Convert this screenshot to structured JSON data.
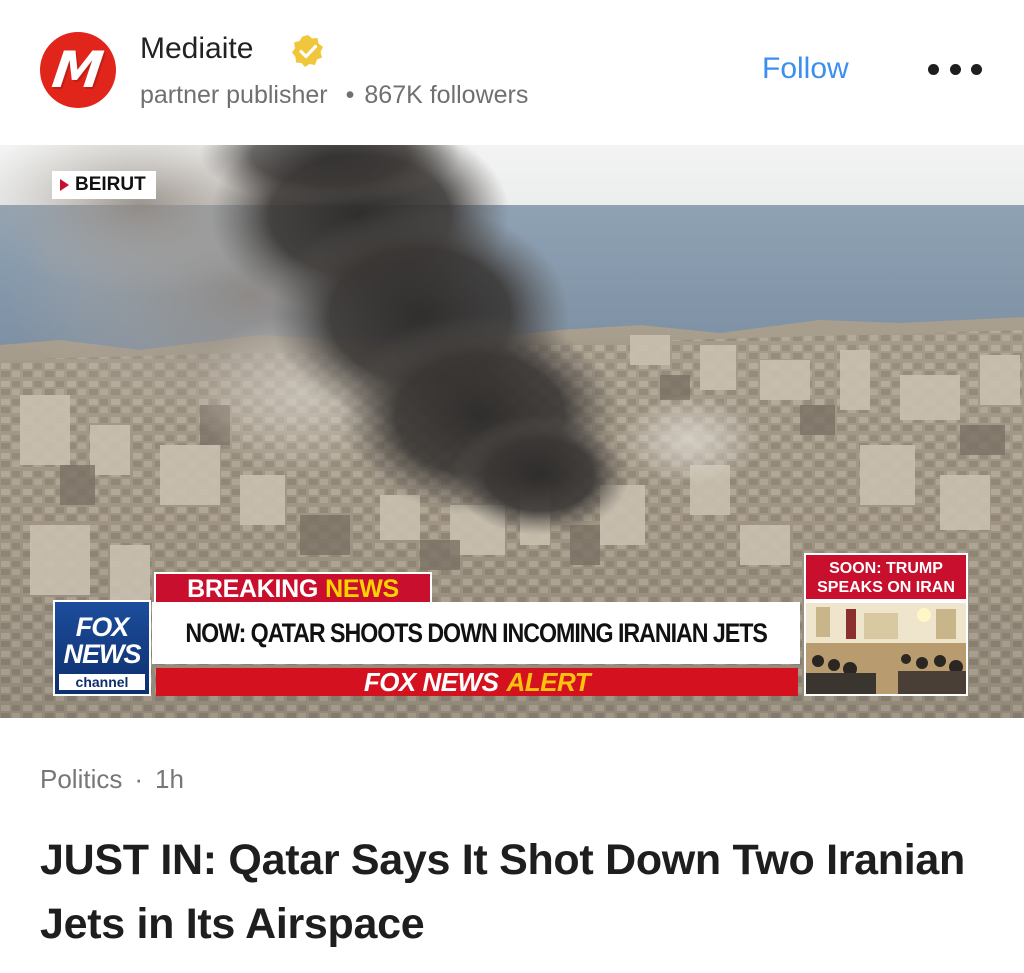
{
  "publisher": {
    "logo_letter": "M",
    "name": "Mediaite",
    "verified": true,
    "role": "partner publisher",
    "followers": "867K followers",
    "follow_label": "Follow",
    "more_icon": "more-icon"
  },
  "media": {
    "dateline": "BEIRUT",
    "breaking_left": "BREAKING",
    "breaking_right": "NEWS",
    "network_logo_top": "FOX",
    "network_logo_bottom": "NEWS",
    "network_logo_channel": "channel",
    "headline": "NOW: QATAR SHOOTS DOWN INCOMING IRANIAN JETS",
    "alert_left": "FOX NEWS",
    "alert_right": "ALERT",
    "soon_line1": "SOON: TRUMP",
    "soon_line2": "SPEAKS ON IRAN"
  },
  "article": {
    "category": "Politics",
    "age": "1h",
    "title": "JUST IN: Qatar Says It Shot Down Two Iranian Jets in Its Airspace"
  },
  "colors": {
    "brand_red": "#e1251b",
    "follow_blue": "#3b8ff0",
    "fox_red": "#c8102e",
    "fox_blue": "#0e2f6e",
    "alert_yellow": "#ffc20e"
  }
}
